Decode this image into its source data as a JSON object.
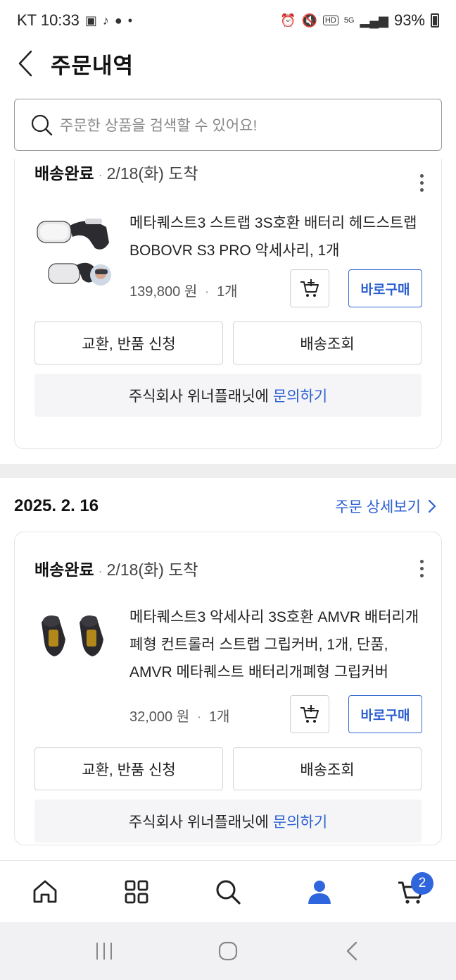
{
  "status_bar": {
    "carrier_time": "KT 10:33",
    "battery": "93%",
    "network": "5G",
    "hd": "HD"
  },
  "header": {
    "title": "주문내역"
  },
  "search": {
    "placeholder": "주문한 상품을 검색할 수 있어요!"
  },
  "orders": [
    {
      "status": "배송완료",
      "arrival": "2/18(화) 도착",
      "product_name": "메타퀘스트3 스트랩 3S호환 배터리 헤드스트랩 BOBOVR S3 PRO 악세사리, 1개",
      "price": "139,800 원",
      "quantity": "1개",
      "buy_now": "바로구매",
      "return_label": "교환, 반품 신청",
      "track_label": "배송조회",
      "seller_text": "주식회사 위너플래닛에",
      "inquiry_link": "문의하기"
    },
    {
      "date": "2025. 2. 16",
      "detail_link": "주문 상세보기",
      "status": "배송완료",
      "arrival": "2/18(화) 도착",
      "product_name": "메타퀘스트3 악세사리 3S호환 AMVR 배터리개폐형 컨트롤러 스트랩 그립커버, 1개, 단품, AMVR 메타퀘스트 배터리개폐형 그립커버",
      "price": "32,000 원",
      "quantity": "1개",
      "buy_now": "바로구매",
      "return_label": "교환, 반품 신청",
      "track_label": "배송조회",
      "seller_text": "주식회사 위너플래닛에",
      "inquiry_link": "문의하기"
    }
  ],
  "bottom_nav": {
    "items": [
      "home-icon",
      "category-icon",
      "search-icon",
      "user-icon",
      "cart-icon"
    ],
    "active": "user-icon",
    "cart_badge": "2"
  },
  "colors": {
    "accent": "#2b5fd1",
    "badge": "#2f66dd"
  }
}
